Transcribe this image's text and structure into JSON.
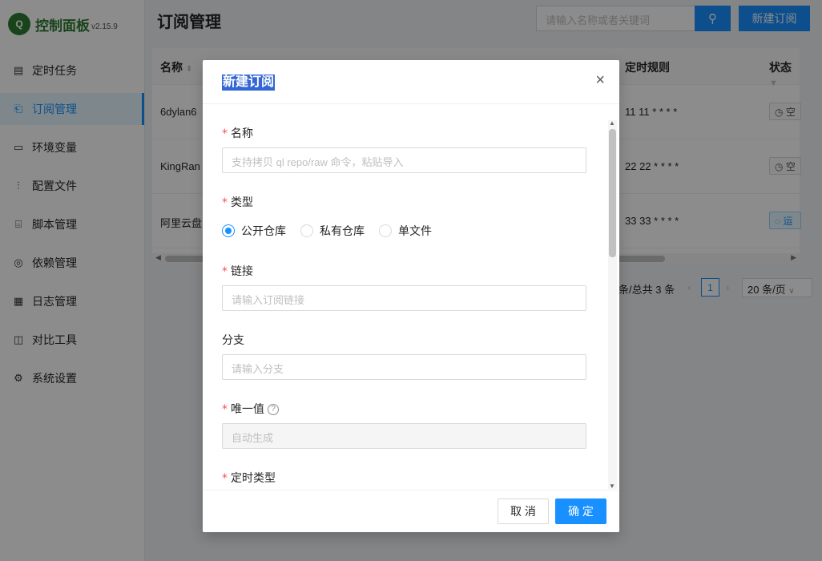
{
  "app": {
    "title": "控制面板",
    "version": "v2.15.9",
    "logo_letter": "Q"
  },
  "sidebar": {
    "items": [
      {
        "label": "定时任务",
        "icon": "calendar-icon"
      },
      {
        "label": "订阅管理",
        "icon": "subscription-icon"
      },
      {
        "label": "环境变量",
        "icon": "monitor-icon"
      },
      {
        "label": "配置文件",
        "icon": "sliders-icon"
      },
      {
        "label": "脚本管理",
        "icon": "code-file-icon"
      },
      {
        "label": "依赖管理",
        "icon": "dependency-icon"
      },
      {
        "label": "日志管理",
        "icon": "log-icon"
      },
      {
        "label": "对比工具",
        "icon": "diff-icon"
      },
      {
        "label": "系统设置",
        "icon": "gear-icon"
      }
    ],
    "active_index": 1
  },
  "header": {
    "page_title": "订阅管理",
    "search_placeholder": "请输入名称或者关键词",
    "new_button": "新建订阅"
  },
  "table": {
    "columns": {
      "name": "名称",
      "schedule": "定时规则",
      "status": "状态"
    },
    "rows": [
      {
        "name": "6dylan6",
        "schedule": "11 11 * * * *",
        "status": "空"
      },
      {
        "name": "KingRan",
        "schedule": "22 22 * * * *",
        "status": "空"
      },
      {
        "name": "阿里云盘",
        "schedule": "33 33 * * * *",
        "status": "运"
      }
    ]
  },
  "pagination": {
    "total_text": "条/总共 3 条",
    "current_page": "1",
    "page_size": "20 条/页"
  },
  "modal": {
    "title": "新建订阅",
    "close": "×",
    "fields": {
      "name": {
        "label": "名称",
        "placeholder": "支持拷贝 ql repo/raw 命令，粘贴导入"
      },
      "type": {
        "label": "类型",
        "options": [
          "公开仓库",
          "私有仓库",
          "单文件"
        ],
        "selected": "公开仓库"
      },
      "url": {
        "label": "链接",
        "placeholder": "请输入订阅链接"
      },
      "branch": {
        "label": "分支",
        "placeholder": "请输入分支"
      },
      "unique": {
        "label": "唯一值",
        "placeholder": "自动生成",
        "help": "?"
      },
      "schedule_type": {
        "label": "定时类型"
      }
    },
    "cancel": "取 消",
    "ok": "确 定"
  },
  "colors": {
    "primary": "#1890ff",
    "brand_green": "#2e7d32",
    "required": "#ff4d4f",
    "mask": "rgba(0,0,0,0.45)"
  }
}
